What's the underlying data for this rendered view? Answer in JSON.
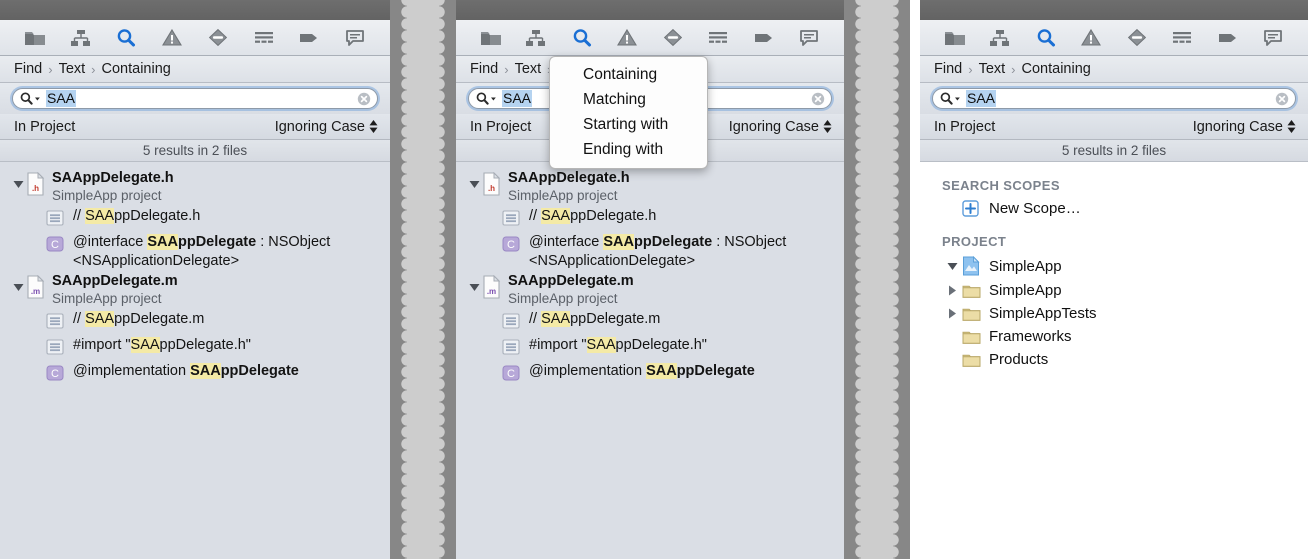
{
  "toolbar": {
    "icons": [
      {
        "name": "folder-icon",
        "label": "Project navigator",
        "active": false
      },
      {
        "name": "hierarchy-icon",
        "label": "Symbol navigator",
        "active": false
      },
      {
        "name": "search-icon",
        "label": "Find navigator",
        "active": true
      },
      {
        "name": "warning-icon",
        "label": "Issue navigator",
        "active": false
      },
      {
        "name": "stop-icon",
        "label": "Test navigator",
        "active": false
      },
      {
        "name": "list-icon",
        "label": "Debug navigator",
        "active": false
      },
      {
        "name": "tag-icon",
        "label": "Breakpoint navigator",
        "active": false
      },
      {
        "name": "report-icon",
        "label": "Report navigator",
        "active": false
      }
    ]
  },
  "breadcrumb": {
    "items": [
      "Find",
      "Text",
      "Containing"
    ],
    "separator": "›"
  },
  "search": {
    "value": "SAA",
    "placeholder": "",
    "magnifier_icon": "search-icon",
    "dropdown_icon": "chevron-down-icon",
    "clear_icon": "clear-icon"
  },
  "options": {
    "scope_label": "In Project",
    "case_label": "Ignoring Case",
    "stepper_icon": "stepper-icon"
  },
  "results_summary": "5 results in 2 files",
  "results": [
    {
      "file_name": "SAAppDelegate.h",
      "file_sub": "SimpleApp project",
      "file_icon": "header-file-icon",
      "file_icon_ext": ".h",
      "expanded": true,
      "matches": [
        {
          "icon": "line-icon",
          "pre": "// ",
          "hit": "SAA",
          "post": "ppDelegate.h",
          "bold": false,
          "tail": ""
        },
        {
          "icon": "class-icon",
          "pre": "@interface ",
          "hit": "SAA",
          "post": "ppDelegate",
          "bold": true,
          "tail": " : NSObject <NSApplicationDelegate>"
        }
      ]
    },
    {
      "file_name": "SAAppDelegate.m",
      "file_sub": "SimpleApp project",
      "file_icon": "implementation-file-icon",
      "file_icon_ext": ".m",
      "expanded": true,
      "matches": [
        {
          "icon": "line-icon",
          "pre": "// ",
          "hit": "SAA",
          "post": "ppDelegate.m",
          "bold": false,
          "tail": ""
        },
        {
          "icon": "line-icon",
          "pre": "#import \"",
          "hit": "SAA",
          "post": "ppDelegate.h\"",
          "bold": false,
          "tail": ""
        },
        {
          "icon": "class-icon",
          "pre": "@implementation ",
          "hit": "SAA",
          "post": "ppDelegate",
          "bold": true,
          "tail": ""
        }
      ]
    }
  ],
  "popup": {
    "items": [
      "Containing",
      "Matching",
      "Starting with",
      "Ending with"
    ],
    "selected": "Containing"
  },
  "scopes": {
    "search_scopes_header": "SEARCH SCOPES",
    "new_scope_label": "New Scope…",
    "new_scope_icon": "plus-icon",
    "project_header": "PROJECT",
    "project_root": {
      "label": "SimpleApp",
      "icon": "xcode-project-icon",
      "expanded": true
    },
    "project_children": [
      {
        "label": "SimpleApp",
        "icon": "folder-icon",
        "has_twisty": true
      },
      {
        "label": "SimpleAppTests",
        "icon": "folder-icon",
        "has_twisty": true
      },
      {
        "label": "Frameworks",
        "icon": "folder-icon",
        "has_twisty": false
      },
      {
        "label": "Products",
        "icon": "folder-icon",
        "has_twisty": false
      }
    ]
  },
  "colors": {
    "accent_blue": "#1a6fd4",
    "highlight_yellow": "#f4eaa6",
    "selection_blue": "#b5d3f0",
    "panel_bg": "#dadee5",
    "titlebar": "#696969",
    "tear": "#cdcdcd"
  }
}
